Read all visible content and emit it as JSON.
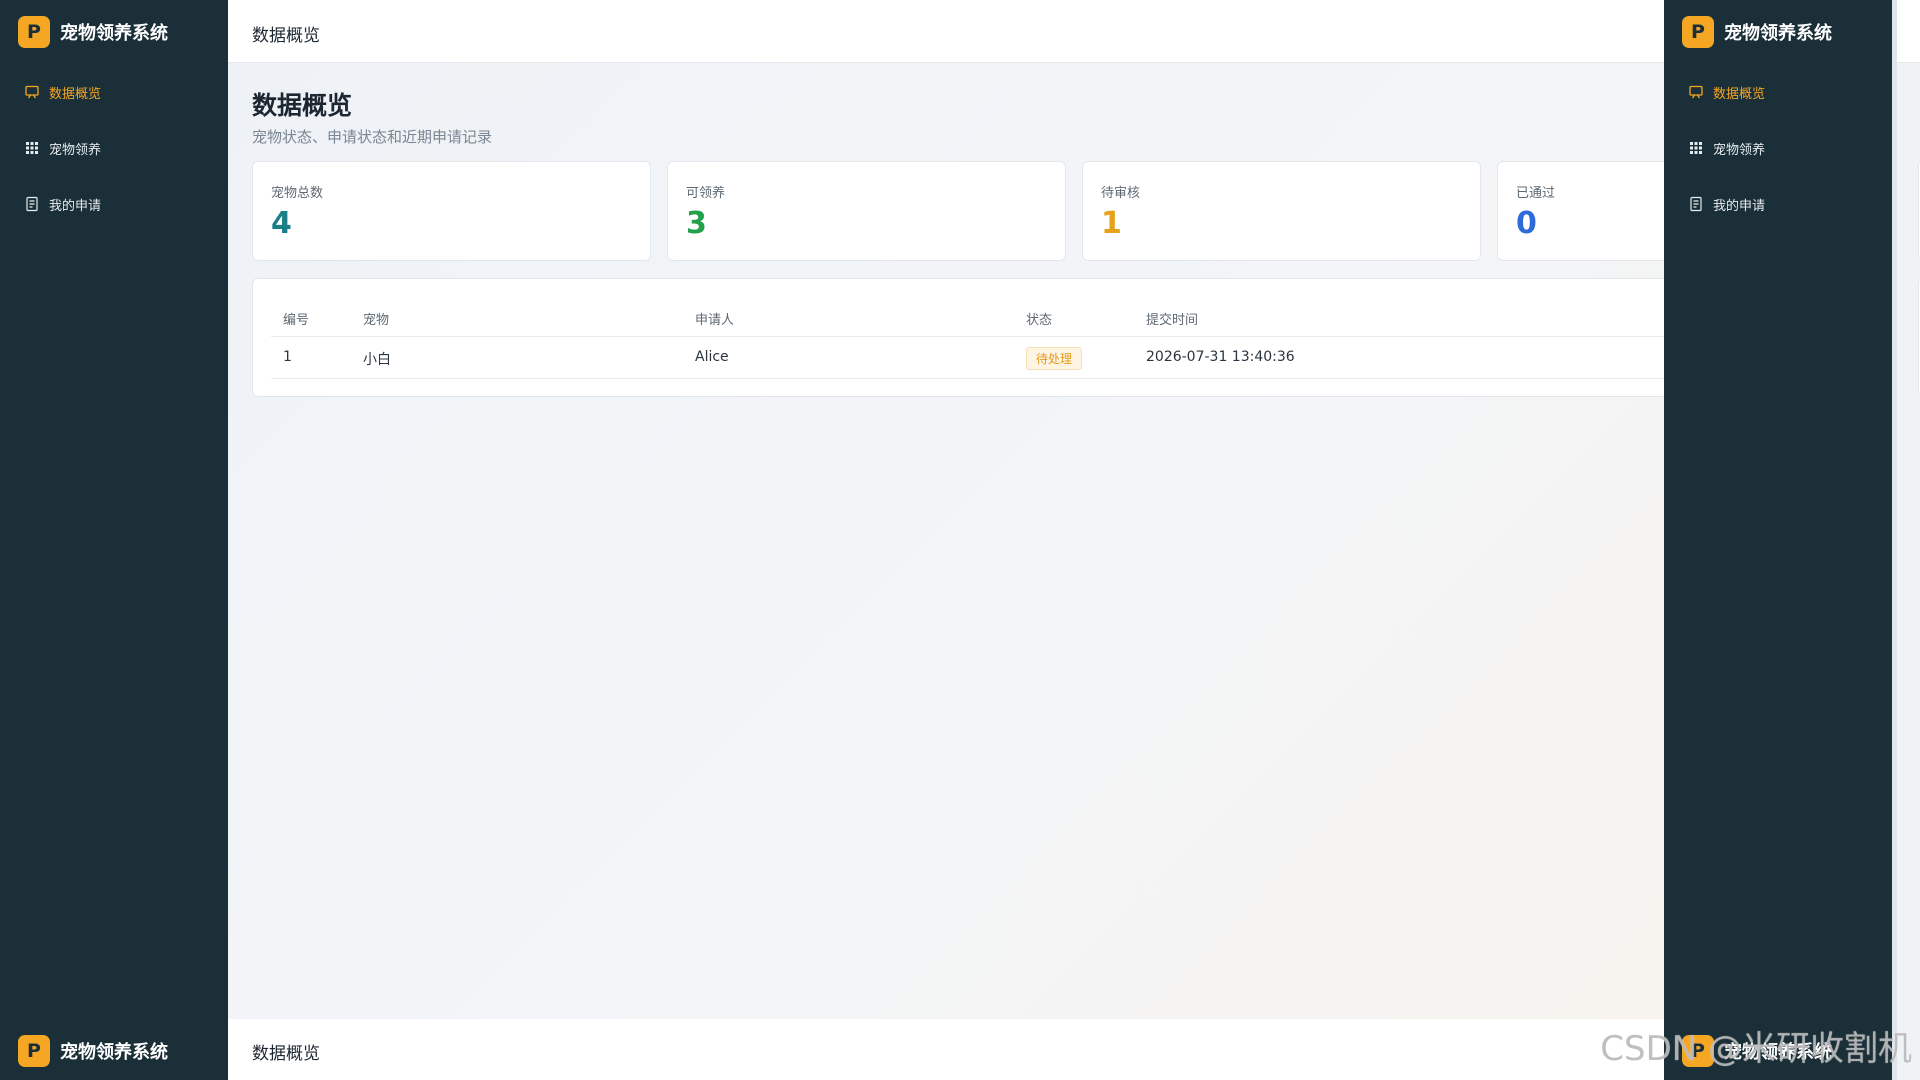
{
  "app": {
    "logo_letter": "P",
    "name": "宠物领养系统"
  },
  "sidebar": {
    "items": [
      {
        "label": "数据概览",
        "icon": "dashboard-icon",
        "active": true
      },
      {
        "label": "宠物领养",
        "icon": "grid-icon",
        "active": false
      },
      {
        "label": "我的申请",
        "icon": "document-icon",
        "active": false
      }
    ]
  },
  "topbar": {
    "title": "数据概览"
  },
  "page": {
    "title": "数据概览",
    "subtitle": "宠物状态、申请状态和近期申请记录"
  },
  "stats": [
    {
      "label": "宠物总数",
      "value": "4",
      "color": "#1a7f86"
    },
    {
      "label": "可领养",
      "value": "3",
      "color": "#23a04a"
    },
    {
      "label": "待审核",
      "value": "1",
      "color": "#e6a11a"
    },
    {
      "label": "已通过",
      "value": "0",
      "color": "#2f6bd8"
    }
  ],
  "table": {
    "headers": [
      "编号",
      "宠物",
      "申请人",
      "状态",
      "提交时间"
    ],
    "rows": [
      {
        "id": "1",
        "pet": "小白",
        "applicant": "Alice",
        "status": "待处理",
        "time": "2026-07-31 13:40:36"
      }
    ]
  },
  "bottom": {
    "title": "数据概览"
  },
  "watermark": "CSDN @米研收割机",
  "colors": {
    "sidebar_bg": "#1b2f38",
    "accent": "#f5a623"
  }
}
